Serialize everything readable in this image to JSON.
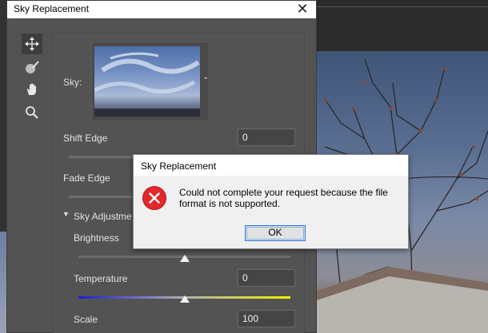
{
  "dialog": {
    "title": "Sky Replacement",
    "close_glyph": "✕"
  },
  "tools": [
    {
      "name": "move-icon",
      "active": true
    },
    {
      "name": "sky-brush-icon"
    },
    {
      "name": "hand-icon"
    },
    {
      "name": "zoom-icon"
    }
  ],
  "panel": {
    "sky_label": "Sky:",
    "shift_edge_label": "Shift Edge",
    "shift_edge_value": "0",
    "fade_edge_label": "Fade Edge",
    "sky_adjustments_label": "Sky Adjustme",
    "brightness_label": "Brightness",
    "brightness_level": 0.5,
    "temperature_label": "Temperature",
    "temperature_value": "0",
    "temperature_level": 0.5,
    "scale_label": "Scale",
    "scale_value": "100"
  },
  "error": {
    "title": "Sky Replacement",
    "message": "Could not complete your request because the file format is not supported.",
    "ok_label": "OK",
    "icon": "error-x-icon"
  },
  "colors": {
    "panel_bg": "#535353",
    "accent_error": "#e0282a",
    "focus_blue": "#2a77d8",
    "temperature_gradient": [
      "#1e1ed2",
      "#f0f000"
    ]
  }
}
